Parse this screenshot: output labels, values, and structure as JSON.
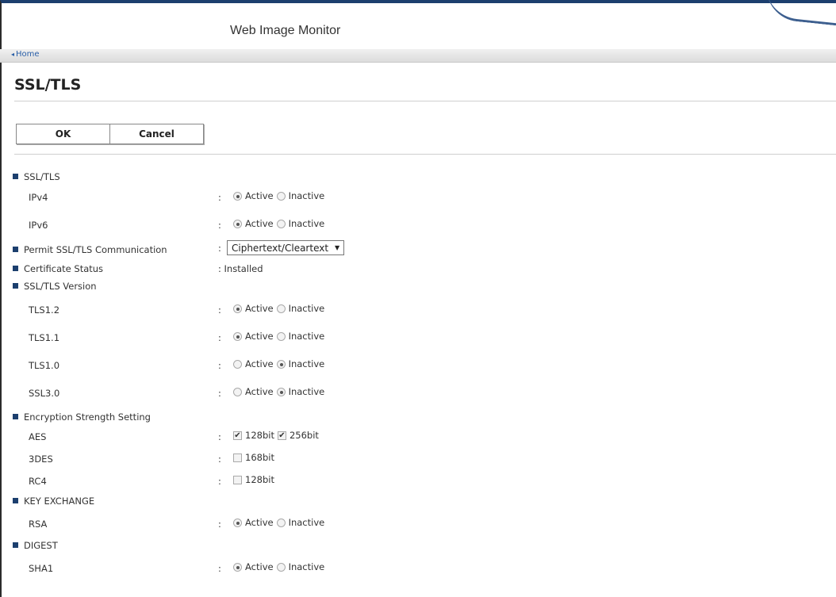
{
  "header": {
    "app_title": "Web Image Monitor"
  },
  "nav": {
    "home_label": "Home"
  },
  "page": {
    "title": "SSL/TLS"
  },
  "buttons": {
    "ok": "OK",
    "cancel": "Cancel"
  },
  "form": {
    "ssl_tls": {
      "heading": "SSL/TLS",
      "ipv4": {
        "label": "IPv4",
        "selected": "Active"
      },
      "ipv6": {
        "label": "IPv6",
        "selected": "Active"
      }
    },
    "permit": {
      "heading": "Permit SSL/TLS Communication",
      "value": "Ciphertext/Cleartext"
    },
    "cert_status": {
      "heading": "Certificate Status",
      "value": ": Installed"
    },
    "version": {
      "heading": "SSL/TLS Version",
      "tls12": {
        "label": "TLS1.2",
        "selected": "Active"
      },
      "tls11": {
        "label": "TLS1.1",
        "selected": "Active"
      },
      "tls10": {
        "label": "TLS1.0",
        "selected": "Inactive"
      },
      "ssl30": {
        "label": "SSL3.0",
        "selected": "Inactive"
      }
    },
    "encryption": {
      "heading": "Encryption Strength Setting",
      "aes": {
        "label": "AES",
        "opt1": "128bit",
        "opt1_checked": true,
        "opt2": "256bit",
        "opt2_checked": true
      },
      "des3": {
        "label": "3DES",
        "opt1": "168bit",
        "opt1_checked": false
      },
      "rc4": {
        "label": "RC4",
        "opt1": "128bit",
        "opt1_checked": false
      }
    },
    "key_exchange": {
      "heading": "KEY EXCHANGE",
      "rsa": {
        "label": "RSA",
        "selected": "Active"
      }
    },
    "digest": {
      "heading": "DIGEST",
      "sha1": {
        "label": "SHA1",
        "selected": "Active"
      }
    },
    "options": {
      "active": "Active",
      "inactive": "Inactive"
    },
    "colon": ":"
  }
}
